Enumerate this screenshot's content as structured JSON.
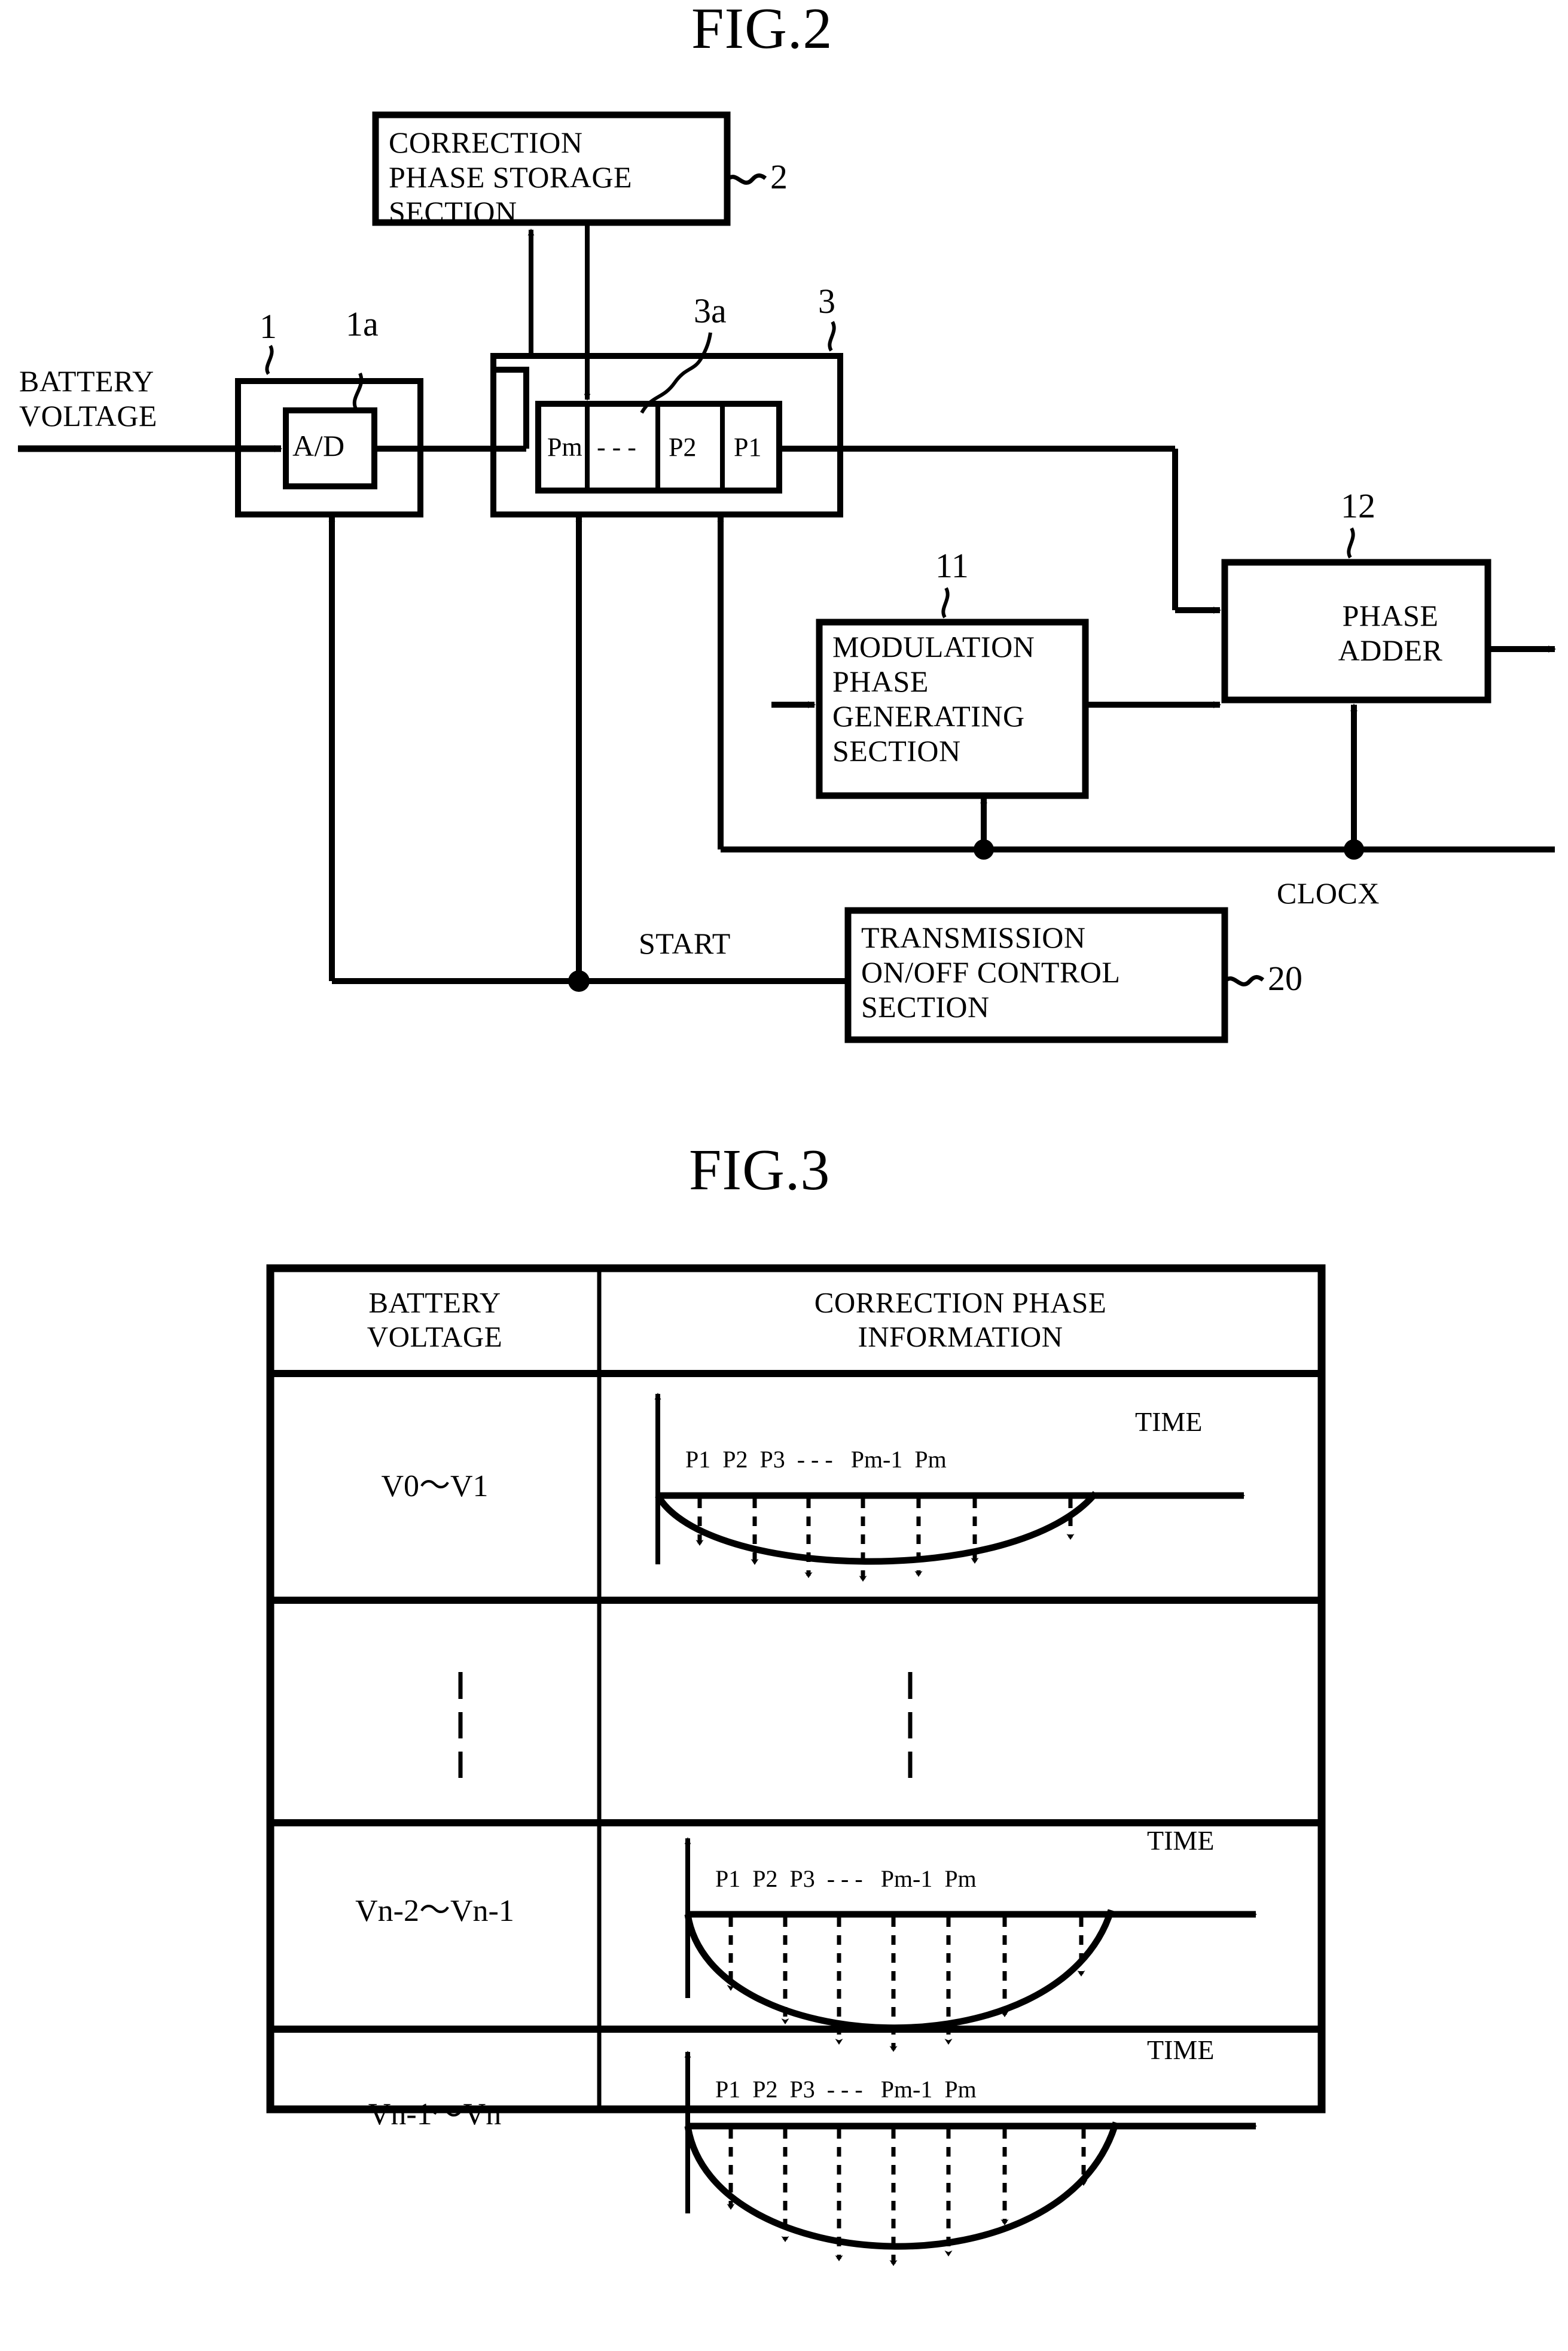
{
  "figures": [
    {
      "title": "FIG.2",
      "type": "block-diagram",
      "blocks": [
        {
          "id": "correction-phase-storage",
          "label": "CORRECTION\nPHASE STORAGE\nSECTION",
          "ref": "2"
        },
        {
          "id": "ad-outer",
          "label": "",
          "ref": "1"
        },
        {
          "id": "ad-converter",
          "label": "A/D",
          "ref": "1a"
        },
        {
          "id": "register-outer",
          "label": "",
          "ref": "3"
        },
        {
          "id": "register-inner",
          "label": "",
          "ref": "3a"
        },
        {
          "id": "modulation-phase-generating",
          "label": "MODULATION\nPHASE\nGENERATING\nSECTION",
          "ref": "11"
        },
        {
          "id": "phase-adder",
          "label": "PHASE\nADDER",
          "ref": "12"
        },
        {
          "id": "transmission-onoff-control",
          "label": "TRANSMISSION\nON/OFF CONTROL\nSECTION",
          "ref": "20"
        }
      ],
      "register_cells": [
        "Pm",
        "- - -",
        "P2",
        "P1"
      ],
      "signals": {
        "battery_voltage": "BATTERY\nVOLTAGE",
        "start": "START",
        "clock": "CLOCX"
      },
      "refs": {
        "r1": "1",
        "r1a": "1a",
        "r2": "2",
        "r3": "3",
        "r3a": "3a",
        "r11": "11",
        "r12": "12",
        "r20": "20"
      }
    },
    {
      "title": "FIG.3",
      "type": "table",
      "columns": [
        "BATTERY\nVOLTAGE",
        "CORRECTION PHASE\nINFORMATION"
      ],
      "rows": [
        {
          "voltage": "V0～V1",
          "plot": {
            "depth": 0.42,
            "time_label": "TIME",
            "phase_labels": "P1  P2  P3  - - -   Pm-1  Pm"
          }
        },
        {
          "voltage": "⋮",
          "plot": null
        },
        {
          "voltage": "Vn-2～Vn-1",
          "plot": {
            "depth": 0.82,
            "time_label": "TIME",
            "phase_labels": "P1  P2  P3  - - -   Pm-1  Pm"
          }
        },
        {
          "voltage": "Vn-1～Vn",
          "plot": {
            "depth": 1.0,
            "time_label": "TIME",
            "phase_labels": "P1  P2  P3  - - -   Pm-1  Pm"
          }
        }
      ]
    }
  ],
  "colors": {
    "ink": "#000000",
    "paper": "#ffffff"
  }
}
